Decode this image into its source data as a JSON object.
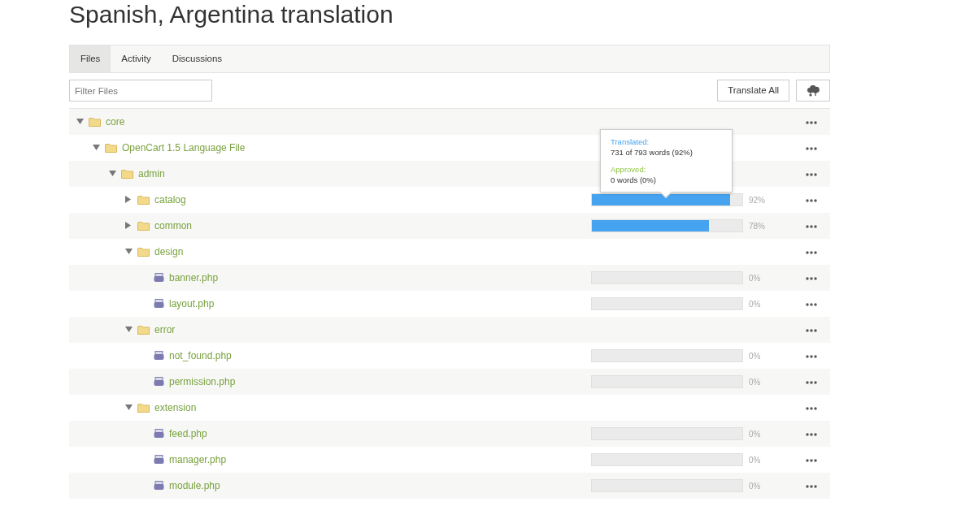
{
  "title": "Spanish, Argentina translation",
  "tabs": [
    {
      "label": "Files",
      "selected": true
    },
    {
      "label": "Activity",
      "selected": false
    },
    {
      "label": "Discussions",
      "selected": false
    }
  ],
  "filter": {
    "placeholder": "Filter Files"
  },
  "translate_all": "Translate All",
  "tree": [
    {
      "kind": "folder",
      "name": "core",
      "expanded": true,
      "children": [
        {
          "kind": "folder",
          "name": "OpenCart 1.5 Language File",
          "expanded": true,
          "children": [
            {
              "kind": "folder",
              "name": "admin",
              "expanded": true,
              "children": [
                {
                  "kind": "folder",
                  "name": "catalog",
                  "expanded": false,
                  "level": 0.92,
                  "percent": "92%"
                },
                {
                  "kind": "folder",
                  "name": "common",
                  "expanded": false,
                  "level": 0.78,
                  "percent": "78%"
                },
                {
                  "kind": "folder",
                  "name": "design",
                  "expanded": true,
                  "children": [
                    {
                      "kind": "file",
                      "name": "banner.php",
                      "level": 0,
                      "percent": "0%"
                    },
                    {
                      "kind": "file",
                      "name": "layout.php",
                      "level": 0,
                      "percent": "0%"
                    }
                  ]
                },
                {
                  "kind": "folder",
                  "name": "error",
                  "expanded": true,
                  "children": [
                    {
                      "kind": "file",
                      "name": "not_found.php",
                      "level": 0,
                      "percent": "0%"
                    },
                    {
                      "kind": "file",
                      "name": "permission.php",
                      "level": 0,
                      "percent": "0%"
                    }
                  ]
                },
                {
                  "kind": "folder",
                  "name": "extension",
                  "expanded": true,
                  "children": [
                    {
                      "kind": "file",
                      "name": "feed.php",
                      "level": 0,
                      "percent": "0%"
                    },
                    {
                      "kind": "file",
                      "name": "manager.php",
                      "level": 0,
                      "percent": "0%"
                    },
                    {
                      "kind": "file",
                      "name": "module.php",
                      "level": 0,
                      "percent": "0%"
                    }
                  ]
                }
              ]
            }
          ]
        }
      ]
    }
  ],
  "tooltip": {
    "translated_label": "Translated:",
    "translated_value": "731 of 793 words (92%)",
    "approved_label": "Approved:",
    "approved_value": "0 words (0%)"
  }
}
